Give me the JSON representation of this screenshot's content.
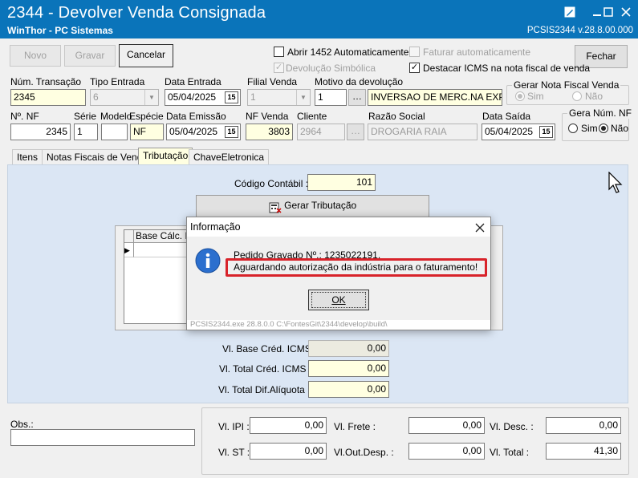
{
  "window": {
    "title": "2344 - Devolver Venda Consignada",
    "subtitle": "WinThor - PC Sistemas",
    "version": "PCSIS2344  v.28.8.00.000"
  },
  "toolbar": {
    "novo": "Novo",
    "gravar": "Gravar",
    "cancelar": "Cancelar",
    "fechar": "Fechar"
  },
  "options": {
    "abrir1452": "Abrir 1452 Automaticamente",
    "devolucao_simbolica": "Devolução Simbólica",
    "faturar_auto": "Faturar automaticamente",
    "destacar_icms": "Destacar ICMS na nota fiscal de venda"
  },
  "form": {
    "num_transacao_label": "Núm. Transação",
    "num_transacao": "2345",
    "tipo_entrada_label": "Tipo Entrada",
    "tipo_entrada": "6",
    "data_entrada_label": "Data Entrada",
    "data_entrada": "05/04/2025",
    "filial_venda_label": "Filial Venda",
    "filial_venda": "1",
    "motivo_label": "Motivo da devolução",
    "motivo_cod": "1",
    "motivo_desc": "INVERSAO DE MERC.NA EXPEDICA",
    "gerar_nf_label": "Gerar Nota Fiscal Venda",
    "sim": "Sim",
    "nao": "Não",
    "num_nf_label": "Nº. NF",
    "num_nf": "2345",
    "serie_label": "Série",
    "serie": "1",
    "modelo_label": "Modelo",
    "modelo": "",
    "especie_label": "Espécie",
    "especie": "NF",
    "data_emissao_label": "Data Emissão",
    "data_emissao": "05/04/2025",
    "nf_venda_label": "NF Venda",
    "nf_venda": "3803",
    "cliente_label": "Cliente",
    "cliente": "2964",
    "razao_label": "Razão Social",
    "razao": "DROGARIA RAIA",
    "data_saida_label": "Data Saída",
    "data_saida": "05/04/2025",
    "gera_num_nf_label": "Gera Núm. NF"
  },
  "tabs": [
    "Itens",
    "Notas Fiscais de Venda",
    "Tributação",
    "ChaveEletronica"
  ],
  "tributacao": {
    "codigo_contabil_label": "Código Contábil :",
    "codigo_contabil": "101",
    "gerar_btn": "Gerar Tributação",
    "grid_header": "Base Cálc. IC",
    "vl_base_cred_label": "Vl. Base Créd. ICMS :",
    "vl_base_cred": "0,00",
    "vl_total_cred_label": "Vl. Total Créd. ICMS :",
    "vl_total_cred": "0,00",
    "vl_dif_label": "Vl. Total Dif.Alíquota :",
    "vl_dif": "0,00"
  },
  "footer": {
    "obs_label": "Obs.:",
    "obs": "",
    "ipi_label": "Vl. IPI :",
    "ipi": "0,00",
    "frete_label": "Vl. Frete :",
    "frete": "0,00",
    "desc_label": "Vl. Desc. :",
    "desc": "0,00",
    "st_label": "Vl. ST :",
    "st": "0,00",
    "outdesp_label": "Vl.Out.Desp. :",
    "outdesp": "0,00",
    "total_label": "Vl. Total :",
    "total": "41,30"
  },
  "dialog": {
    "title": "Informação",
    "line1": "Pedido Gravado Nº.: 1235022191.",
    "line2": "Aguardando autorização da indústria para o faturamento!",
    "ok": "OK",
    "footer": "PCSIS2344.exe 28.8.0.0 C:\\FontesGit\\2344\\develop\\build\\",
    "icon": "info-icon",
    "highlight_color": "#d8232a"
  },
  "colors": {
    "titlebar": "#0a74ba",
    "panel": "#dbe6f4",
    "field_yellow": "#ffffe1"
  }
}
